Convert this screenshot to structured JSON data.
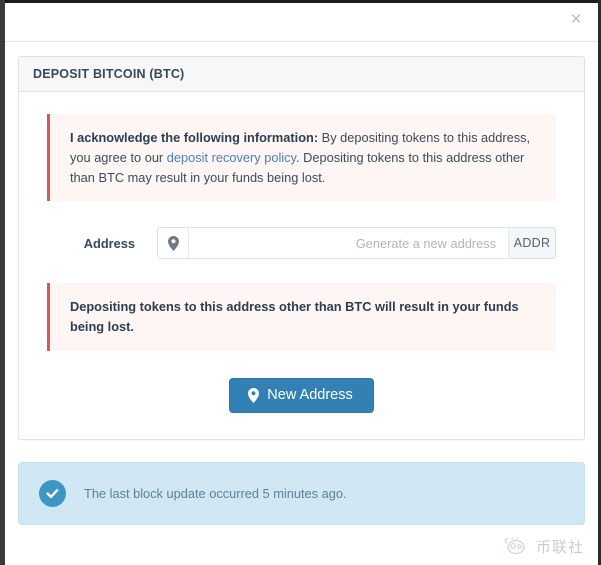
{
  "window": {
    "close_label": "×"
  },
  "panel": {
    "title": "DEPOSIT BITCOIN (BTC)"
  },
  "acknowledge_alert": {
    "strong_prefix": "I acknowledge the following information:",
    "text_part_1": " By depositing tokens to this address, you agree to our ",
    "link_label": "deposit recovery policy",
    "text_part_2": ". Depositing tokens to this address other than BTC may result in your funds being lost."
  },
  "address_field": {
    "label": "Address",
    "icon": "map-marker-icon",
    "value": "",
    "placeholder": "Generate a new address",
    "suffix_label": "ADDR"
  },
  "warning_alert": {
    "text": "Depositing tokens to this address other than BTC will result in your funds being lost."
  },
  "new_address_button": {
    "label": "New Address",
    "icon": "map-marker-icon"
  },
  "info_alert": {
    "icon": "check-circle-icon",
    "message": "The last block update occurred 5 minutes ago."
  },
  "watermark": {
    "text": "币联社"
  },
  "colors": {
    "primary": "#3380b5",
    "danger_border": "#d15b57",
    "danger_bg": "#fdf6f5",
    "info_bg": "#cfe8f3",
    "info_icon": "#3d96c4",
    "info_text": "#5b8296",
    "link": "#4a80b5",
    "panel_heading_bg": "#f7f7f7"
  }
}
